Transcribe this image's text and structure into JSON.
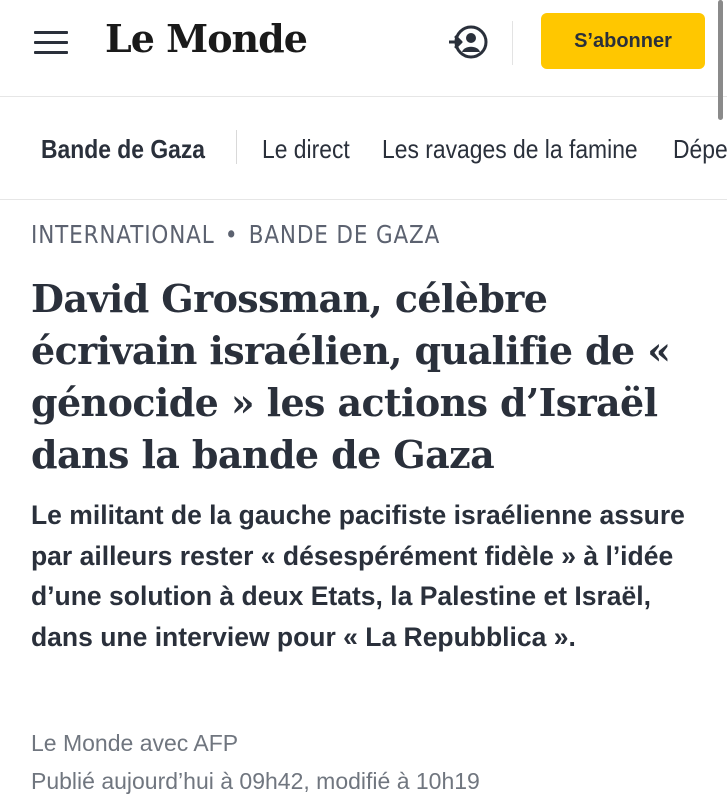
{
  "header": {
    "logo_text": "Le Monde",
    "menu_icon": "hamburger-menu-icon",
    "account_icon": "user-account-icon",
    "subscribe_label": "S’abonner",
    "accent_color": "#ffc700"
  },
  "nav": {
    "items": [
      {
        "label": "Bande de Gaza",
        "active": true
      },
      {
        "label": "Le direct"
      },
      {
        "label": "Les ravages de la famine"
      },
      {
        "label": "Dépendance"
      }
    ]
  },
  "article": {
    "kicker": {
      "section": "INTERNATIONAL",
      "separator": "•",
      "subsection": "BANDE DE GAZA"
    },
    "headline": "David Grossman, célèbre écrivain israélien, qualifie de « génocide » les actions d’Israël dans la bande de Gaza",
    "standfirst": "Le militant de la gauche pacifiste israélienne assure par ailleurs rester « désespérément fidèle » à l’idée d’une solution à deux Etats, la Palestine et Israël, dans une interview pour « La Repubblica ».",
    "author": "Le Monde avec AFP",
    "dateline": "Publié aujourd’hui à 09h42, modifié à 10h19"
  }
}
